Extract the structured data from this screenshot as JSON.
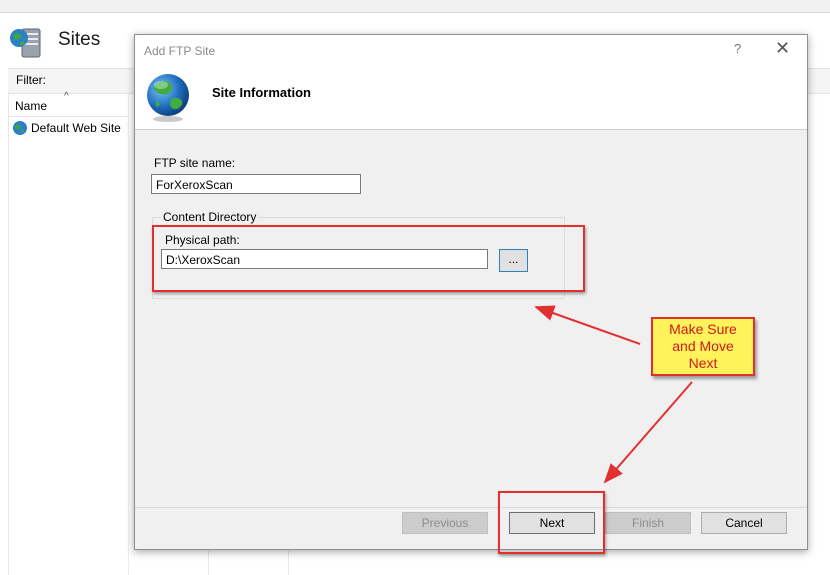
{
  "background_window": {
    "header_title": "Sites",
    "filter_label": "Filter:",
    "column_name": "Name",
    "sites": [
      {
        "name": "Default Web Site",
        "icon": "globe-icon"
      }
    ]
  },
  "dialog": {
    "title": "Add FTP Site",
    "help_glyph": "?",
    "close_glyph": "✕",
    "banner_title": "Site Information",
    "site_name_label": "FTP site name:",
    "site_name_value": "ForXeroxScan",
    "content_directory_label": "Content Directory",
    "physical_path_label": "Physical path:",
    "physical_path_value": "D:\\XeroxScan",
    "browse_label": "...",
    "buttons": {
      "previous": "Previous",
      "next": "Next",
      "finish": "Finish",
      "cancel": "Cancel"
    }
  },
  "annotation": {
    "lines": [
      "Make Sure",
      "and Move",
      "Next"
    ],
    "color": "#e23030",
    "background": "#fef35a"
  }
}
